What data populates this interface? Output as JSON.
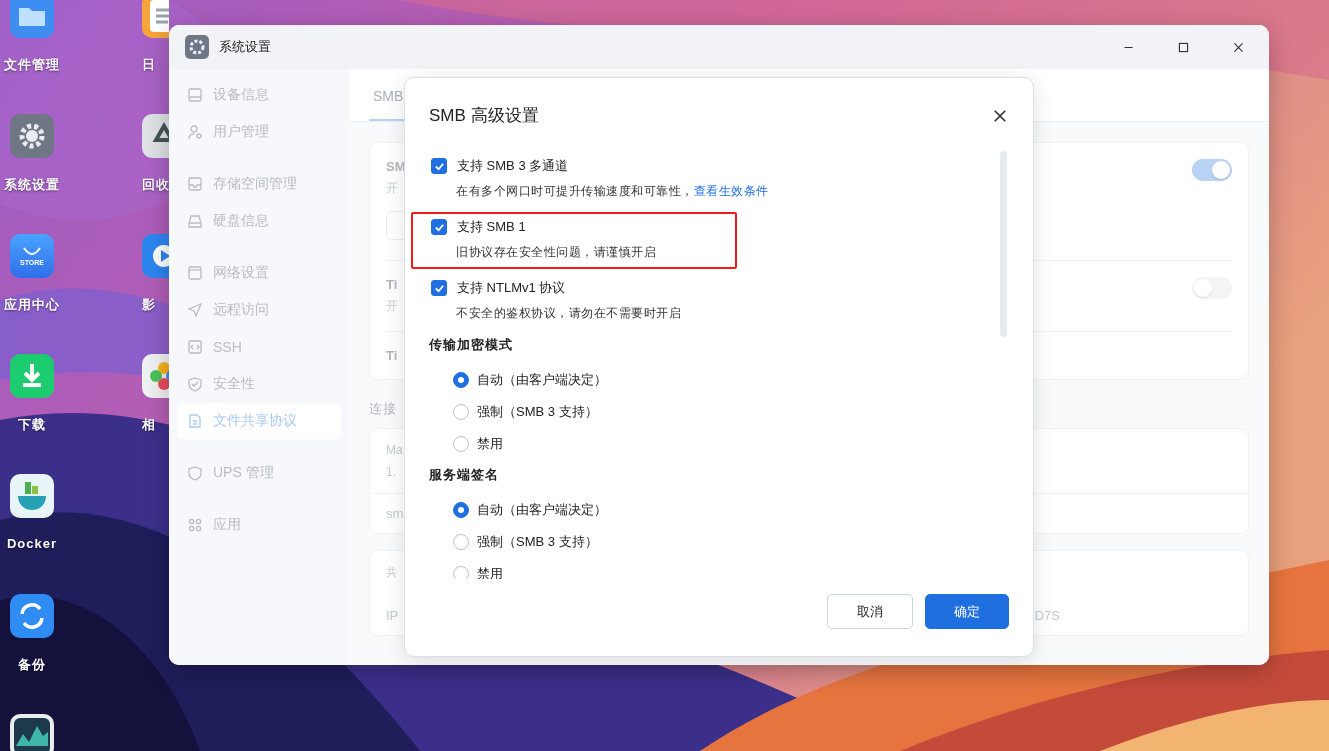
{
  "desktop": {
    "icons": [
      {
        "label": "文件管理"
      },
      {
        "label": "系统设置"
      },
      {
        "label": "应用中心",
        "badge": "STORE"
      },
      {
        "label": "下载"
      },
      {
        "label": "Docker"
      },
      {
        "label": "备份"
      },
      {
        "label": "日"
      },
      {
        "label": "回收"
      },
      {
        "label": "影"
      },
      {
        "label": "相"
      }
    ]
  },
  "window": {
    "title": "系统设置",
    "sidebar": {
      "groups": [
        {
          "items": [
            {
              "label": "设备信息",
              "selected": false
            },
            {
              "label": "用户管理",
              "selected": false
            }
          ]
        },
        {
          "items": [
            {
              "label": "存储空间管理",
              "selected": false
            },
            {
              "label": "硬盘信息",
              "selected": false
            }
          ]
        },
        {
          "items": [
            {
              "label": "网络设置",
              "selected": false
            },
            {
              "label": "远程访问",
              "selected": false
            },
            {
              "label": "SSH",
              "selected": false
            },
            {
              "label": "安全性",
              "selected": false
            },
            {
              "label": "文件共享协议",
              "selected": true
            }
          ]
        },
        {
          "items": [
            {
              "label": "UPS 管理",
              "selected": false
            }
          ]
        },
        {
          "items": [
            {
              "label": "应用",
              "selected": false
            }
          ]
        }
      ]
    },
    "tabs": [
      {
        "label": "SMB",
        "selected": true
      }
    ],
    "settings_card": {
      "rows": [
        {
          "title": "SM",
          "description": "开",
          "on": true
        },
        {
          "title": "Ti",
          "description": "开",
          "on": false
        },
        {
          "title": "Ti"
        }
      ]
    },
    "section_title": "连接",
    "connection_card": {
      "rows": [
        "Ma",
        "1.",
        "sm"
      ]
    },
    "share_card": {
      "heading": "共",
      "ip_label": "IP",
      "value": "D7S"
    }
  },
  "dialog": {
    "title": "SMB 高级设置",
    "checkboxes": [
      {
        "label": "支持 SMB 3 多通道",
        "description": "在有多个网口时可提升传输速度和可靠性，",
        "link": "查看生效条件",
        "checked": true,
        "highlighted": false
      },
      {
        "label": "支持 SMB 1",
        "description": "旧协议存在安全性问题，请谨慎开启",
        "checked": true,
        "highlighted": true
      },
      {
        "label": "支持 NTLMv1 协议",
        "description": "不安全的鉴权协议，请勿在不需要时开启",
        "checked": true,
        "highlighted": false
      }
    ],
    "groups": [
      {
        "title": "传输加密模式",
        "options": [
          {
            "label": "自动（由客户端决定）",
            "selected": true
          },
          {
            "label": "强制（SMB 3 支持）",
            "selected": false
          },
          {
            "label": "禁用",
            "selected": false
          }
        ]
      },
      {
        "title": "服务端签名",
        "options": [
          {
            "label": "自动（由客户端决定）",
            "selected": true
          },
          {
            "label": "强制（SMB 3 支持）",
            "selected": false
          },
          {
            "label": "禁用",
            "selected": false
          }
        ]
      }
    ],
    "buttons": [
      {
        "label": "取消",
        "kind": "secondary"
      },
      {
        "label": "确定",
        "kind": "primary"
      }
    ]
  }
}
